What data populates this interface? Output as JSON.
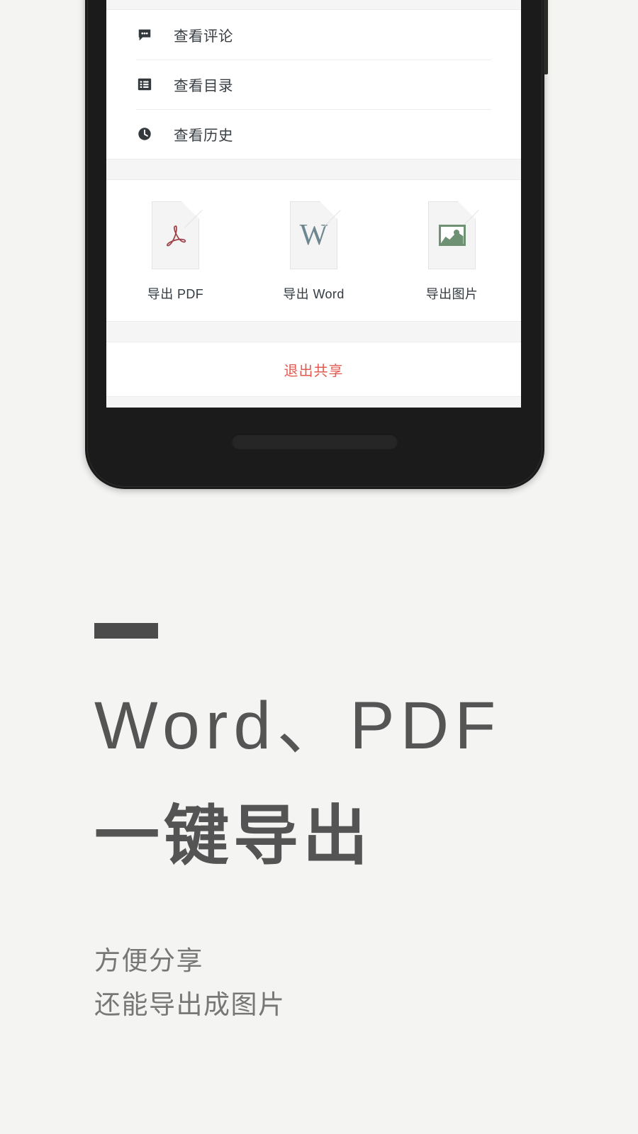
{
  "theme": {
    "page_background": "#f4f4f3",
    "accent_bar_color": "#4b4b4b",
    "headline_color": "#555555",
    "subtitle_color": "#777777",
    "exit_color": "#e05a4f",
    "pdf_color": "#9e4048",
    "word_color": "#6d8690",
    "image_color": "#6f9173"
  },
  "phone": {
    "frame_color": "#1b1b1b",
    "screen_background": "#ffffff"
  },
  "sheet": {
    "menu_items": [
      {
        "icon": "comment-icon",
        "label": "查看评论"
      },
      {
        "icon": "list-icon",
        "label": "查看目录"
      },
      {
        "icon": "clock-icon",
        "label": "查看历史"
      }
    ],
    "export_items": [
      {
        "icon": "pdf-file-icon",
        "glyph": "A",
        "label": "导出 PDF"
      },
      {
        "icon": "word-file-icon",
        "glyph": "W",
        "label": "导出 Word"
      },
      {
        "icon": "image-file-icon",
        "glyph": "",
        "label": "导出图片"
      }
    ],
    "exit_label": "退出共享"
  },
  "promo": {
    "headline_line1": "Word、PDF",
    "headline_line2": "一键导出",
    "subtitle_line1": "方便分享",
    "subtitle_line2": "还能导出成图片"
  }
}
